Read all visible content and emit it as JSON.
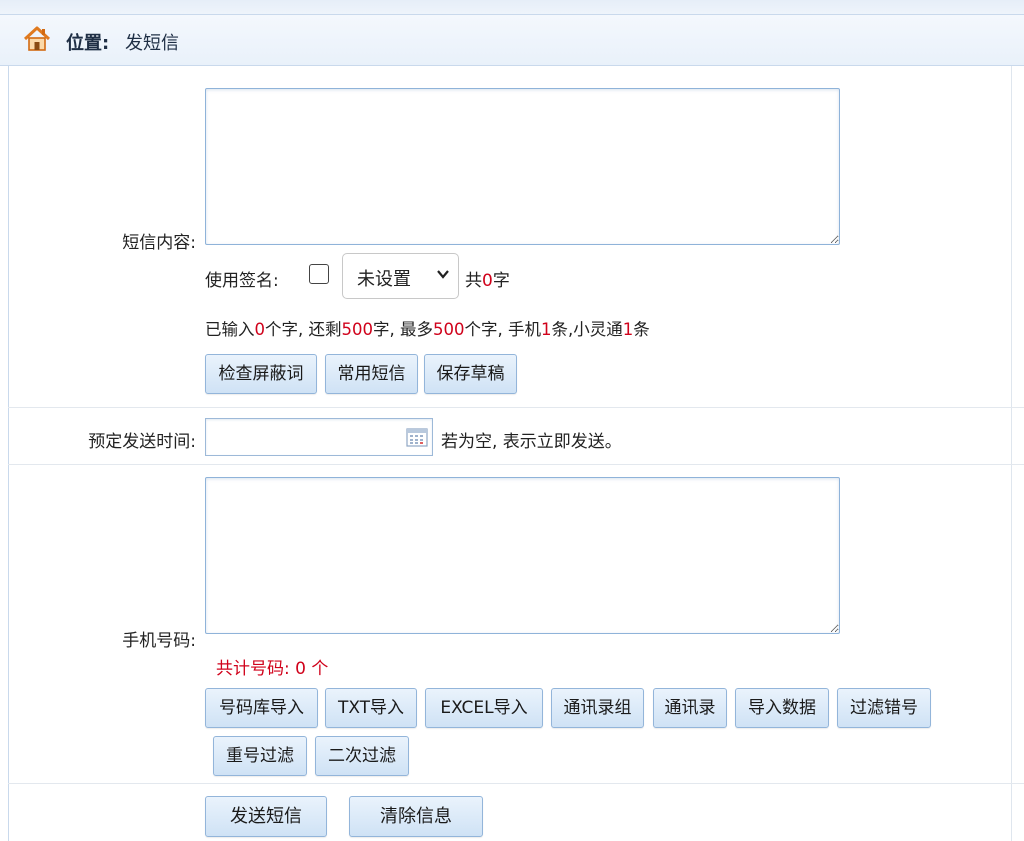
{
  "header": {
    "location_label": "位置:",
    "location_value": "发短信",
    "home_icon": "home-icon"
  },
  "sms_content": {
    "label": "短信内容:",
    "text": "",
    "signature_label": "使用签名:",
    "signature_checked": false,
    "signature_select": "未设置",
    "total_prefix": "共",
    "total_count": "0",
    "total_suffix": "字",
    "counter": {
      "part1": "已输入",
      "typed": "0",
      "part2": "个字, 还剩",
      "remaining": "500",
      "part3": "字, 最多",
      "max": "500",
      "part4": "个字, 手机",
      "mobile_count": "1",
      "part5": "条,小灵通",
      "phs_count": "1",
      "part6": "条"
    },
    "buttons": {
      "check_words": "检查屏蔽词",
      "common_sms": "常用短信",
      "save_draft": "保存草稿"
    }
  },
  "schedule": {
    "label": "预定发送时间:",
    "value": "",
    "hint": "若为空, 表示立即发送。",
    "calendar_icon": "calendar-icon"
  },
  "phones": {
    "label": "手机号码:",
    "text": "",
    "total_label": "共计号码: ",
    "total_count": "0",
    "total_unit": " 个",
    "buttons": {
      "db_import": "号码库导入",
      "txt_import": "TXT导入",
      "excel_import": "EXCEL导入",
      "contact_group": "通讯录组",
      "contacts": "通讯录",
      "import_data": "导入数据",
      "filter_wrong": "过滤错号",
      "dedupe": "重号过滤",
      "second_filter": "二次过滤"
    }
  },
  "actions": {
    "send": "发送短信",
    "clear": "清除信息"
  },
  "colors": {
    "accent_red": "#d0021b",
    "button_border": "#93b5da",
    "header_bg": "#e9f1fa"
  }
}
